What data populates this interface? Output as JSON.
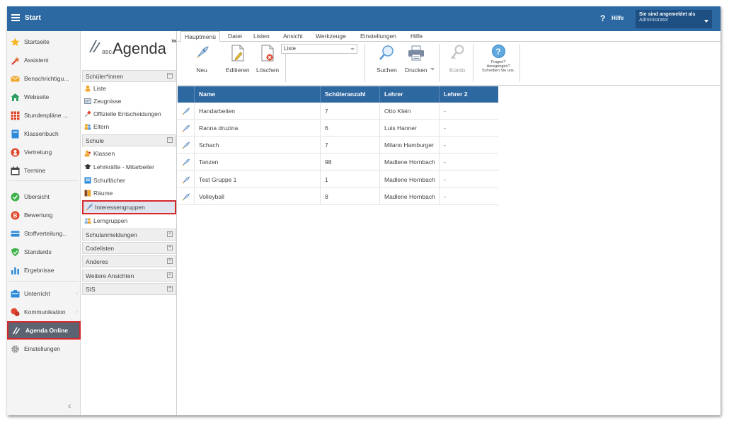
{
  "topbar": {
    "title": "Start",
    "help_label": "Hilfe",
    "help_glyph": "?",
    "user_line1": "Sie sind angemeldet als",
    "user_line2": "Administrator"
  },
  "leftnav": {
    "items": [
      {
        "label": "Startseite",
        "icon": "star-icon"
      },
      {
        "label": "Assistent",
        "icon": "wand-icon"
      },
      {
        "label": "Benachrichtigu...",
        "icon": "envelope-icon"
      },
      {
        "label": "Webseite",
        "icon": "home-icon"
      },
      {
        "label": "Stundenpläne ...",
        "icon": "timetable-icon"
      },
      {
        "label": "Klassenbuch",
        "icon": "book-icon"
      },
      {
        "label": "Vertretung",
        "icon": "substitute-icon"
      },
      {
        "label": "Termine",
        "icon": "calendar-icon"
      },
      {
        "label": "Übersicht",
        "icon": "check-circle-icon"
      },
      {
        "label": "Bewertung",
        "icon": "grade-icon"
      },
      {
        "label": "Stoffverteilung...",
        "icon": "distribution-icon"
      },
      {
        "label": "Standards",
        "icon": "shield-icon"
      },
      {
        "label": "Ergebnisse",
        "icon": "bar-chart-icon"
      },
      {
        "label": "Unterricht",
        "icon": "lesson-icon"
      },
      {
        "label": "Kommunikation",
        "icon": "chat-icon"
      },
      {
        "label": "Agenda Online",
        "icon": "agenda-online-icon"
      },
      {
        "label": "Einstellungen",
        "icon": "gear-icon"
      }
    ],
    "collapse_glyph": "‹"
  },
  "module": {
    "logo": {
      "asc": "asc",
      "agenda": "Agenda",
      "tm": "TM"
    },
    "sections": [
      {
        "label": "Schüler*innen",
        "toggle": "−"
      },
      {
        "label": "Schule",
        "toggle": "−"
      },
      {
        "label": "Schulanmeldungen",
        "toggle": "+"
      },
      {
        "label": "Codelisten",
        "toggle": "+"
      },
      {
        "label": "Anderes",
        "toggle": "+"
      },
      {
        "label": "Weitere Ansichten",
        "toggle": "+"
      },
      {
        "label": "SIS",
        "toggle": "+"
      }
    ],
    "items": [
      {
        "label": "Liste",
        "icon": "student-icon"
      },
      {
        "label": "Zeugnisse",
        "icon": "certificate-icon"
      },
      {
        "label": "Offizielle Entscheidungen",
        "icon": "pin-icon"
      },
      {
        "label": "Eltern",
        "icon": "parents-icon"
      },
      {
        "label": "Klassen",
        "icon": "classes-icon"
      },
      {
        "label": "Lehrkräfte - Mitarbeiter",
        "icon": "graduation-cap-icon"
      },
      {
        "label": "Schulfächer",
        "icon": "subject-icon"
      },
      {
        "label": "Räume",
        "icon": "room-icon"
      },
      {
        "label": "Interessengruppen",
        "icon": "rocket-icon"
      },
      {
        "label": "Lerngruppen",
        "icon": "group-icon"
      }
    ]
  },
  "ribbon": {
    "tabs": [
      "Hauptmenü",
      "Datei",
      "Listen",
      "Ansicht",
      "Werkzeuge",
      "Einstellungen",
      "Hilfe"
    ],
    "buttons": {
      "new": "Neu",
      "edit": "Editieren",
      "delete": "Löschen",
      "search": "Suchen",
      "print": "Drucken",
      "account": "Konto"
    },
    "list_select_value": "Liste",
    "help_glyph": "?",
    "help_text": [
      "Fragen?",
      "Anregungen?",
      "Schreiben Sie uns."
    ]
  },
  "grid": {
    "columns": [
      "Name",
      "Schüleranzahl",
      "Lehrer",
      "Lehrer 2"
    ],
    "rows": [
      {
        "name": "Handarbeiten",
        "count": "7",
        "teacher": "Otto Klein",
        "teacher2": "-"
      },
      {
        "name": "Ranna druzina",
        "count": "6",
        "teacher": "Luis Hanner",
        "teacher2": "-"
      },
      {
        "name": "Schach",
        "count": "7",
        "teacher": "Milano Hamburger",
        "teacher2": "-"
      },
      {
        "name": "Tanzen",
        "count": "98",
        "teacher": "Madlene Hornbach",
        "teacher2": "-"
      },
      {
        "name": "Test Gruppe 1",
        "count": "1",
        "teacher": "Madlene Hornbach",
        "teacher2": "-"
      },
      {
        "name": "Volleyball",
        "count": "8",
        "teacher": "Madlene Hornbach",
        "teacher2": "-"
      }
    ]
  },
  "colors": {
    "topbar": "#2c69a3",
    "grid_header": "#2e68a0",
    "highlight": "#d6282b",
    "active_nav": "#5b6470"
  }
}
